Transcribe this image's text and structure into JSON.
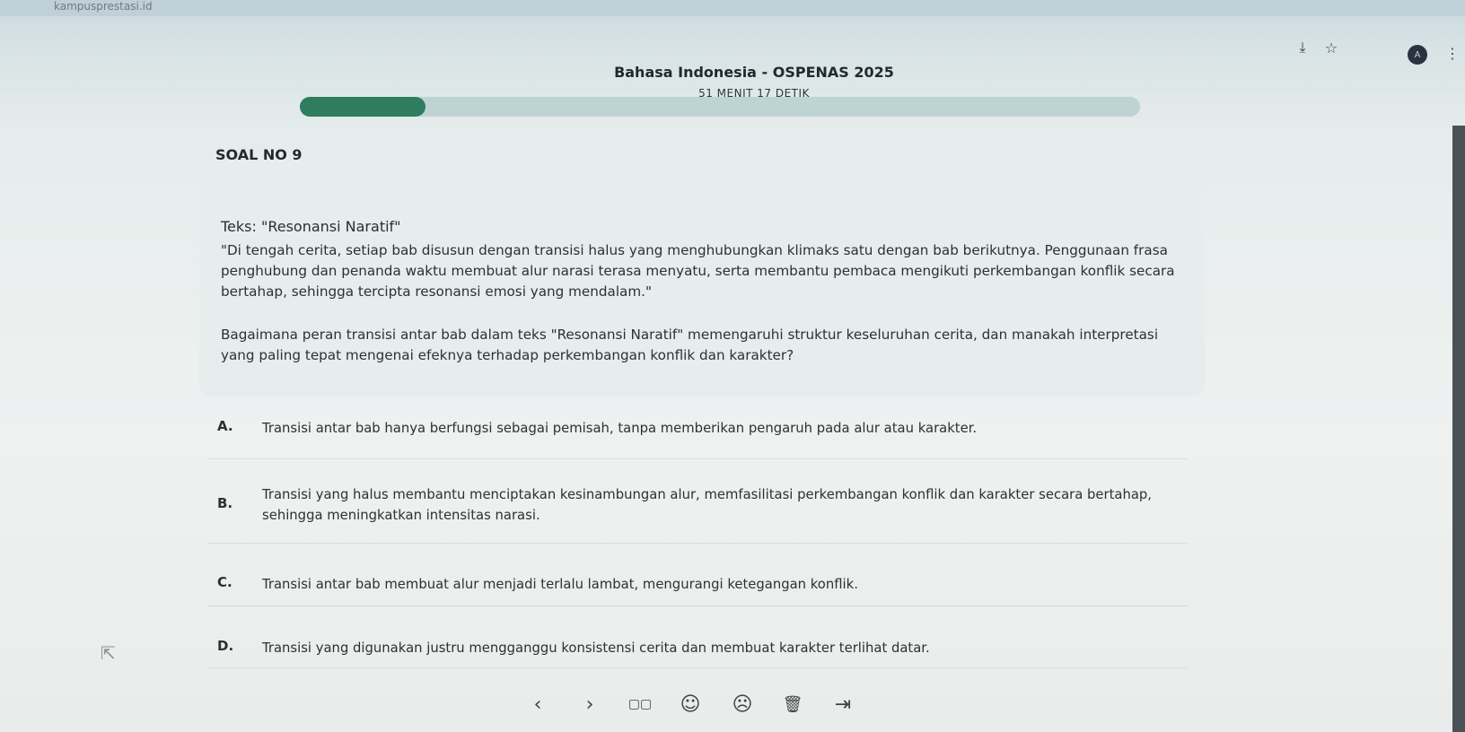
{
  "browser": {
    "tab_text": "kampusprestasi.id",
    "icons": [
      "install-app-icon",
      "bookmark-star-icon",
      "profile-avatar-icon",
      "more-menu-icon"
    ],
    "avatar_initial": "A"
  },
  "exam": {
    "title": "Bahasa Indonesia - OSPENAS 2025",
    "timer": "51 MENIT 17 DETIK",
    "progress_fraction": 0.15,
    "accent_color": "#2f7d5e"
  },
  "question": {
    "number_label": "SOAL NO 9",
    "title": "Teks: \"Resonansi Naratif\"",
    "body": "\"Di tengah cerita, setiap bab disusun dengan transisi halus yang menghubungkan klimaks satu dengan bab berikutnya. Penggunaan frasa penghubung dan penanda waktu membuat alur narasi terasa menyatu, serta membantu pembaca mengikuti perkembangan konflik secara bertahap, sehingga tercipta resonansi emosi yang mendalam.\"",
    "prompt": "Bagaimana peran transisi antar bab dalam teks \"Resonansi Naratif\" memengaruhi struktur keseluruhan cerita, dan manakah interpretasi yang paling tepat mengenai efeknya terhadap perkembangan konflik dan karakter?"
  },
  "options": [
    {
      "letter": "A.",
      "text": "Transisi antar bab hanya berfungsi sebagai pemisah, tanpa memberikan pengaruh pada alur atau karakter."
    },
    {
      "letter": "B.",
      "text": "Transisi yang halus membantu menciptakan kesinambungan alur, memfasilitasi perkembangan konflik dan karakter secara bertahap, sehingga meningkatkan intensitas narasi."
    },
    {
      "letter": "C.",
      "text": "Transisi antar bab membuat alur menjadi terlalu lambat, mengurangi ketegangan konflik."
    },
    {
      "letter": "D.",
      "text": "Transisi yang digunakan justru mengganggu konsistensi cerita dan membuat karakter terlihat datar."
    }
  ],
  "nav": {
    "prev": "‹",
    "next": "›",
    "grid": "▢▢",
    "happy": "☺",
    "sad": "☹",
    "delete": "🗑",
    "submit": "⇥"
  }
}
